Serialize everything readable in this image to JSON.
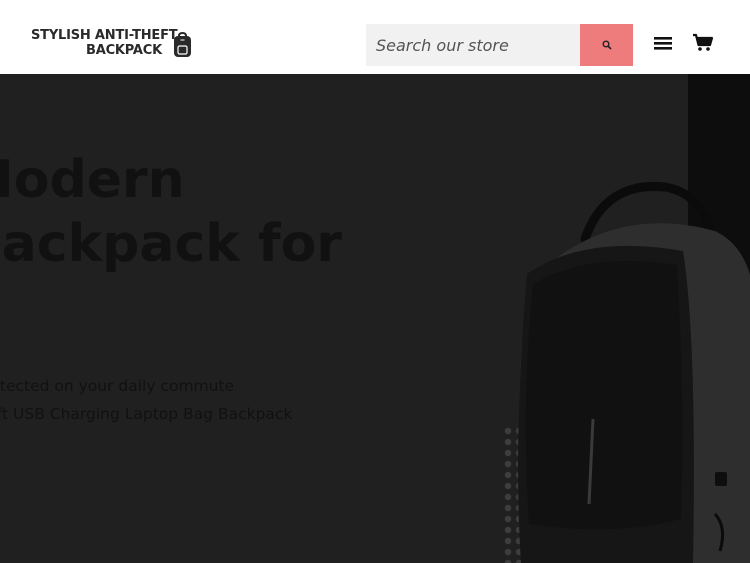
{
  "header": {
    "logo": {
      "line1": "STYLISH ANTI-THEFT",
      "line2": "BACKPACK"
    },
    "search": {
      "placeholder": "Search our store",
      "button_icon": "search-icon"
    },
    "menu_icon": "hamburger-menu-icon",
    "cart_icon": "cart-icon",
    "accent_color": "#ef7c7c"
  },
  "hero": {
    "title_line1": "Modern",
    "title_line2": "Backpack for",
    "subtitle_line1": "Stay protected on your daily commute",
    "subtitle_line2": "Anti-theft USB Charging Laptop Bag Backpack",
    "overlay_color": "#202020"
  }
}
